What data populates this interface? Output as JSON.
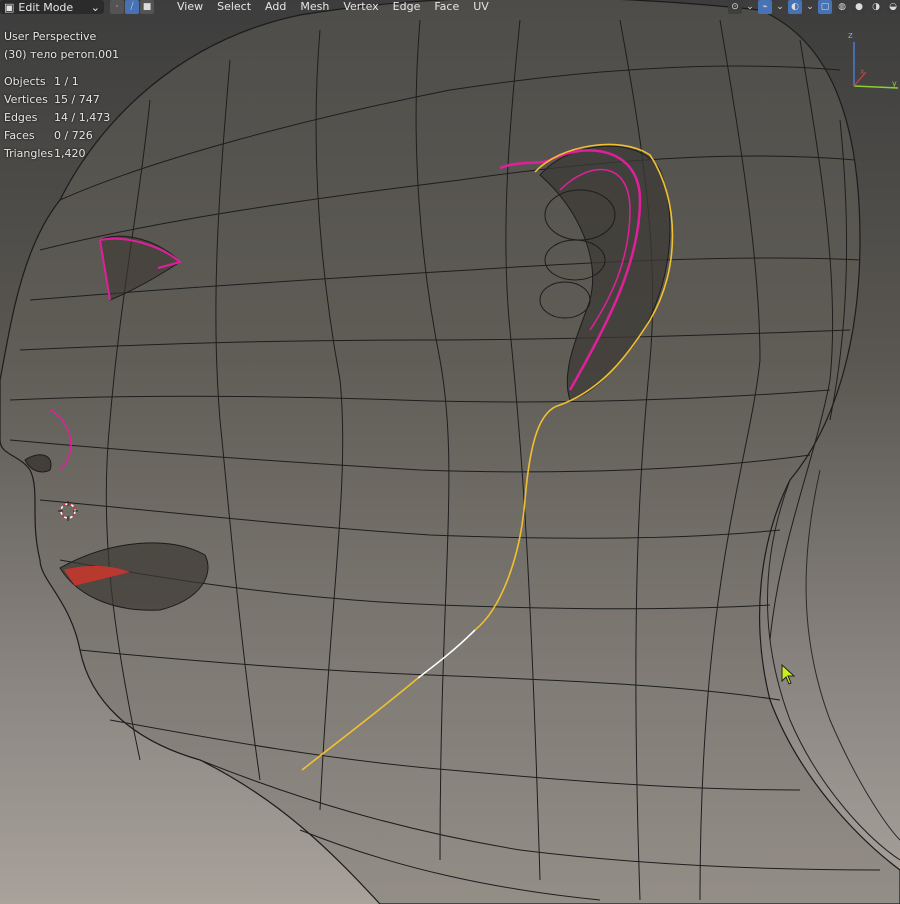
{
  "header": {
    "mode": "Edit Mode",
    "select_modes": [
      "vertex-select",
      "edge-select",
      "face-select"
    ],
    "active_select_mode": "edge-select",
    "menus": [
      "View",
      "Select",
      "Add",
      "Mesh",
      "Vertex",
      "Edge",
      "Face",
      "UV"
    ]
  },
  "viewport": {
    "perspective_label": "User Perspective",
    "object_label": "(30) тело ретоп.001"
  },
  "stats": [
    {
      "label": "Objects",
      "value": "1 / 1"
    },
    {
      "label": "Vertices",
      "value": "15 / 747"
    },
    {
      "label": "Edges",
      "value": "14 / 1,473"
    },
    {
      "label": "Faces",
      "value": "0 / 726"
    },
    {
      "label": "Triangles",
      "value": "1,420"
    }
  ],
  "gizmo": {
    "axes": [
      "z",
      "x",
      "y"
    ]
  },
  "colors": {
    "accent": "#4772b3",
    "selected_edge": "#f0c030",
    "active_edge": "#ffffff",
    "seam": "#e0209a",
    "sharp": "#d03030"
  }
}
